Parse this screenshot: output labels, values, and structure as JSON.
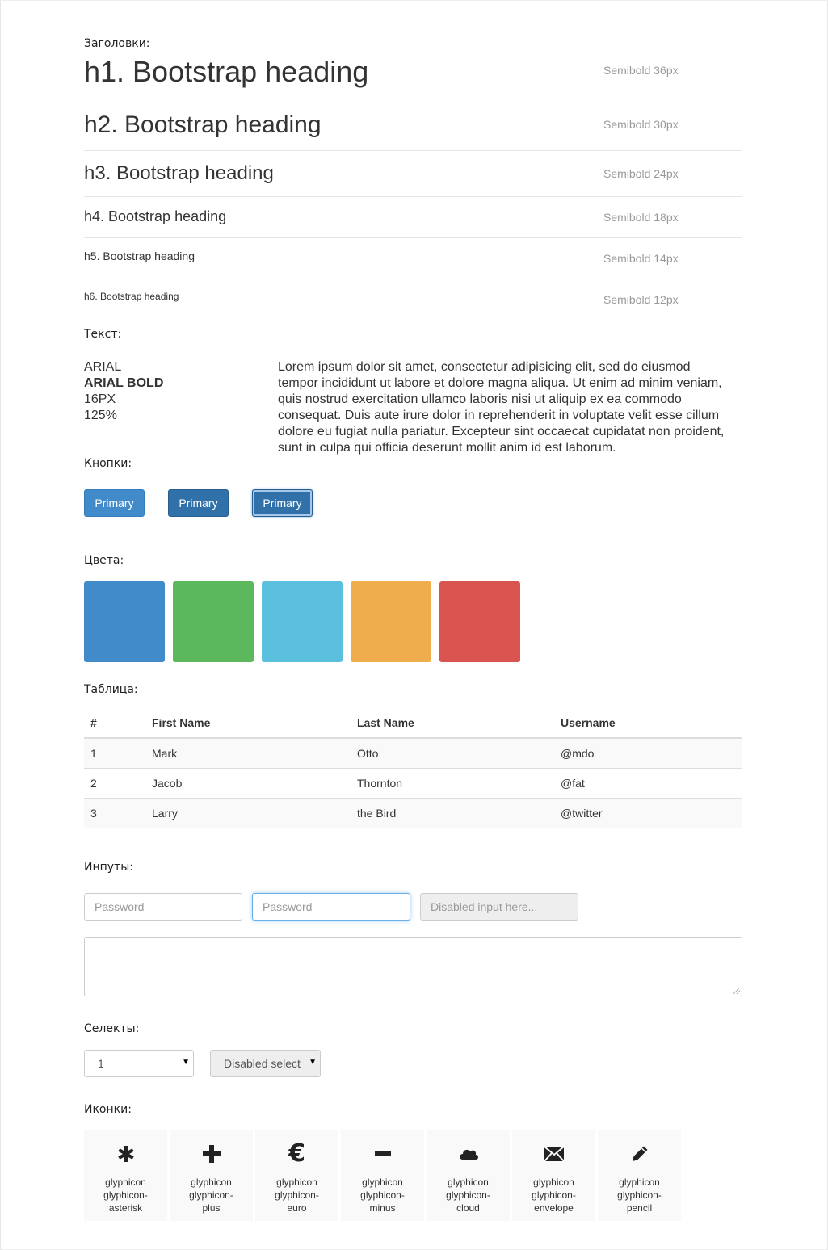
{
  "sections": {
    "headings": "Заголовки:",
    "text": "Текст:",
    "buttons": "Кнопки:",
    "colors": "Цвета:",
    "table": "Таблица:",
    "inputs": "Инпуты:",
    "selects": "Селекты:",
    "icons": "Иконки:"
  },
  "headings": [
    {
      "text": "h1. Bootstrap heading",
      "note": "Semibold 36px"
    },
    {
      "text": "h2. Bootstrap heading",
      "note": "Semibold 30px"
    },
    {
      "text": "h3. Bootstrap heading",
      "note": "Semibold 24px"
    },
    {
      "text": "h4. Bootstrap heading",
      "note": "Semibold 18px"
    },
    {
      "text": "h5. Bootstrap heading",
      "note": "Semibold 14px"
    },
    {
      "text": "h6. Bootstrap heading",
      "note": "Semibold 12px"
    }
  ],
  "font_spec": {
    "family": "ARIAL",
    "bold": "ARIAL BOLD",
    "size": "16PX",
    "line_height": "125%"
  },
  "lorem": "Lorem ipsum dolor sit amet, consectetur adipisicing elit, sed do eiusmod tempor incididunt ut labore et dolore magna aliqua. Ut enim ad minim veniam, quis nostrud exercitation ullamco laboris nisi ut aliquip ex ea commodo consequat. Duis aute irure dolor in reprehenderit in voluptate velit esse cillum dolore eu fugiat nulla pariatur. Excepteur sint occaecat cupidatat non proident, sunt in culpa qui officia deserunt mollit anim id est laborum.",
  "buttons": [
    {
      "label": "Primary",
      "state": "normal"
    },
    {
      "label": "Primary",
      "state": "hover"
    },
    {
      "label": "Primary",
      "state": "focus"
    }
  ],
  "colors": [
    "#428bca",
    "#5cb85c",
    "#5bc0de",
    "#f0ad4e",
    "#d9534f"
  ],
  "table": {
    "headers": [
      "#",
      "First Name",
      "Last Name",
      "Username"
    ],
    "rows": [
      [
        "1",
        "Mark",
        "Otto",
        "@mdo"
      ],
      [
        "2",
        "Jacob",
        "Thornton",
        "@fat"
      ],
      [
        "3",
        "Larry",
        "the Bird",
        "@twitter"
      ]
    ]
  },
  "inputs": {
    "password1_placeholder": "Password",
    "password2_placeholder": "Password",
    "disabled_placeholder": "Disabled input here..."
  },
  "selects": {
    "select1_value": "1",
    "disabled_value": "Disabled select"
  },
  "icons": [
    {
      "name": "glyphicon glyphicon-asterisk",
      "icon": "asterisk-icon"
    },
    {
      "name": "glyphicon glyphicon-plus",
      "icon": "plus-icon"
    },
    {
      "name": "glyphicon glyphicon-euro",
      "icon": "euro-icon"
    },
    {
      "name": "glyphicon glyphicon-minus",
      "icon": "minus-icon"
    },
    {
      "name": "glyphicon glyphicon-cloud",
      "icon": "cloud-icon"
    },
    {
      "name": "glyphicon glyphicon-envelope",
      "icon": "envelope-icon"
    },
    {
      "name": "glyphicon glyphicon-pencil",
      "icon": "pencil-icon"
    }
  ]
}
